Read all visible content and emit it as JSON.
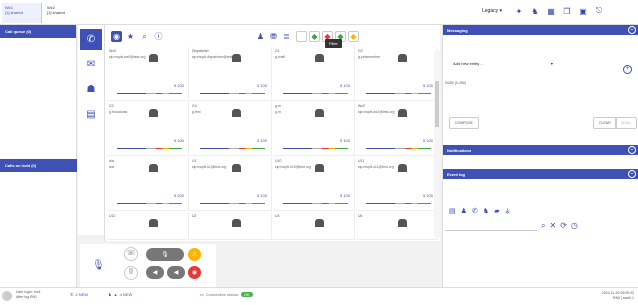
{
  "tabs": [
    {
      "title": "Wz1",
      "sub": "[1] shared"
    },
    {
      "title": "Wz2",
      "sub": "[1] shared"
    }
  ],
  "profile": "Legacy",
  "queue": {
    "call_queue": "Call queue (0)",
    "calls_on_hold": "Calls on hold (0)"
  },
  "tooltip": "Filter",
  "cells": [
    {
      "n1": "Wz0",
      "n2": "sip:mcptt.wz0@test.org",
      "sub": "",
      "ctl": "5 100"
    },
    {
      "n1": "Dispatcher",
      "n2": "sip:mcptt.dispatcher@test.org",
      "sub": "",
      "ctl": "5 100"
    },
    {
      "n1": "G1",
      "n2": "g.shell",
      "sub": "",
      "ctl": "5 100"
    },
    {
      "n1": "G2",
      "n2": "g.pinkmember",
      "sub": "",
      "ctl": "5 100"
    },
    {
      "n1": "G2",
      "n2": "g.broadcast",
      "sub": "",
      "ctl": "5 100"
    },
    {
      "n1": "G4",
      "n2": "g.test",
      "sub": "",
      "ctl": "5 100"
    },
    {
      "n1": "g.m",
      "n2": "g.m",
      "sub": "",
      "ctl": "5 100"
    },
    {
      "n1": "Wz2",
      "n2": "sip:mcptt.wz2@test.org",
      "sub": "",
      "ctl": "5 100"
    },
    {
      "n1": "a/a",
      "n2": "a/a",
      "sub": "",
      "ctl": "5 100"
    },
    {
      "n1": "U1",
      "n2": "sip:mcptt.u1@test.org",
      "sub": "",
      "ctl": "5 100"
    },
    {
      "n1": "U10",
      "n2": "sip:mcptt.u10@test.org",
      "sub": "",
      "ctl": "5 100"
    },
    {
      "n1": "U11",
      "n2": "sip:mcptt.u11@test.org",
      "sub": "",
      "ctl": "5 100"
    },
    {
      "n1": "U12",
      "n2": "",
      "sub": "",
      "ctl": ""
    },
    {
      "n1": "U2",
      "n2": "",
      "sub": "",
      "ctl": ""
    },
    {
      "n1": "U3",
      "n2": "",
      "sub": "",
      "ctl": ""
    },
    {
      "n1": "U4",
      "n2": "",
      "sub": "",
      "ctl": ""
    }
  ],
  "right": {
    "messaging": "Messaging",
    "add_entity": "Add new entity ...",
    "counter": "0/250 (0-250)",
    "compose": "COMPOSE",
    "clear": "CLEAR",
    "send": "SEND",
    "notifications": "Notifications",
    "event_log": "Event log"
  },
  "status": {
    "user_login": "User login: ron1",
    "afterwards": "After log RN1",
    "new_count": "2 NEW",
    "new_count2": "4 NEW",
    "connection": "Connection status:",
    "connection_pill": "OK",
    "datetime": "2022-11-29 09:09:23",
    "subinfo": "RN2 | sw#0.1"
  }
}
